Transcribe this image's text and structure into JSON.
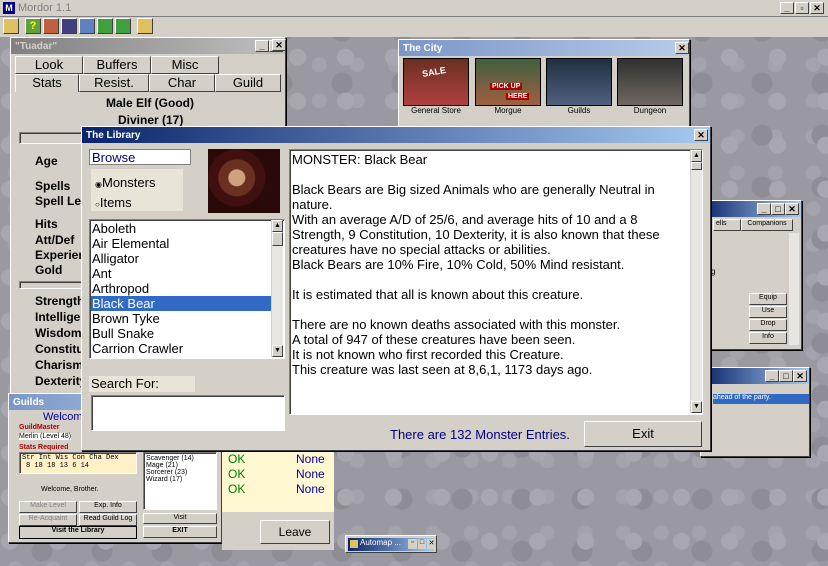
{
  "app": {
    "title": "Mordor 1.1",
    "toolbar_icons": [
      "book-icon",
      "question-icon",
      "grid-icon",
      "tiles-icon",
      "save-icon",
      "person-up-icon",
      "person-down-icon",
      "window-icon"
    ]
  },
  "character": {
    "title": "\"Tuadar\"",
    "tabs_row1": [
      "Look",
      "Buffers",
      "Misc"
    ],
    "tabs_row2": [
      "Stats",
      "Resist.",
      "Char",
      "Guild"
    ],
    "race": "Male Elf (Good)",
    "class": "Diviner (17)",
    "labels": [
      "Age",
      "Spells",
      "Spell Lev",
      "Hits",
      "Att/Def",
      "Experien",
      "Gold",
      "Strength",
      "Intelliger",
      "Wisdom",
      "Constitut",
      "Charisma",
      "Dexterity"
    ]
  },
  "city": {
    "title": "The City",
    "places": [
      "General Store",
      "Morgue",
      "Guilds",
      "Dungeon"
    ],
    "sign_sale": "SALE",
    "sign_pick": "PICK UP",
    "sign_here": "HERE"
  },
  "library": {
    "title": "The Library",
    "browse_label": "Browse",
    "radio_monsters": "Monsters",
    "radio_items": "Items",
    "monsters": [
      "Aboleth",
      "Air Elemental",
      "Alligator",
      "Ant",
      "Arthropod",
      "Black Bear",
      "Brown Tyke",
      "Bull Snake",
      "Carrion Crawler"
    ],
    "selected_index": 5,
    "search_label": "Search For:",
    "search_value": "",
    "detail_lines": [
      "MONSTER: Black Bear",
      "",
      "Black Bears are Big sized Animals who are generally Neutral in nature.",
      "With an average A/D of 25/6, and average hits of 10 and a 8 Strength, 9 Constitution, 10 Dexterity, it is also known that these creatures have no special attacks or abilities.",
      "Black Bears are 10% Fire, 10% Cold, 50% Mind resistant.",
      "",
      "It is estimated that all is known about this creature.",
      "",
      "There are no known deaths associated with this monster.",
      "A total of 947 of these creatures have been seen.",
      "It is not known who first recorded this Creature.",
      "This creature was last seen at 8,6,1, 1173 days ago."
    ],
    "entry_count": "There are 132 Monster Entries.",
    "exit_label": "Exit"
  },
  "party": {
    "col_spells": "ells",
    "col_companions": "Companions",
    "buttons": [
      "Equip",
      "Use",
      "Drop",
      "Info"
    ],
    "letter": "g"
  },
  "messages": {
    "line": "ahead of the party."
  },
  "guilds": {
    "title": "Guilds",
    "welcome": "Welcome",
    "guildmaster_label": "GuildMaster",
    "guildmaster_value": "Merlin (Level 48)",
    "stats_required": "Stats Required",
    "stat_headers": "Str Int Wis Con Cha Dex",
    "stat_values": "8  18  18  13  6  14",
    "greeting": "Welcome, Brother.",
    "make_level": "Make Level",
    "exp_info": "Exp. Info",
    "re_acquaint": "Re-Acquaint",
    "read_guild_log": "Read Guild Log",
    "visit_library": "Visit the Library",
    "guild_list": [
      "Scavenger (14)",
      "Mage (21)",
      "Sorcerer (23)",
      "Wizard (17)"
    ],
    "visit": "Visit",
    "exit": "EXIT"
  },
  "status_list": {
    "rows": [
      [
        "OK",
        "None"
      ],
      [
        "OK",
        "None"
      ],
      [
        "OK",
        "None"
      ]
    ],
    "leave": "Leave"
  },
  "automap": {
    "title": "Automap ..."
  }
}
